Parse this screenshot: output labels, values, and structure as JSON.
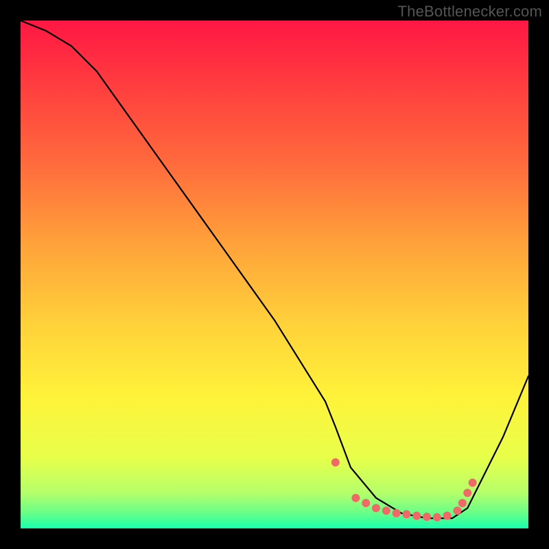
{
  "credit": "TheBottlenecker.com",
  "colors": {
    "bg_black": "#000000",
    "gradient_stops": [
      {
        "offset": 0.0,
        "color": "#ff1744"
      },
      {
        "offset": 0.12,
        "color": "#ff3b3f"
      },
      {
        "offset": 0.28,
        "color": "#ff6a3c"
      },
      {
        "offset": 0.44,
        "color": "#ffa23a"
      },
      {
        "offset": 0.6,
        "color": "#ffd23a"
      },
      {
        "offset": 0.74,
        "color": "#fff23a"
      },
      {
        "offset": 0.86,
        "color": "#e8ff4a"
      },
      {
        "offset": 0.93,
        "color": "#b4ff6a"
      },
      {
        "offset": 0.97,
        "color": "#66ff88"
      },
      {
        "offset": 1.0,
        "color": "#18ffb0"
      }
    ],
    "curve": "#000000",
    "marker_fill": "#f06868",
    "marker_stroke": "#f06868"
  },
  "chart_data": {
    "type": "line",
    "title": "",
    "xlabel": "",
    "ylabel": "",
    "xlim": [
      0,
      100
    ],
    "ylim": [
      0,
      100
    ],
    "series": [
      {
        "name": "bottleneck-curve",
        "x": [
          0,
          5,
          10,
          15,
          20,
          25,
          30,
          35,
          40,
          45,
          50,
          55,
          60,
          62,
          65,
          70,
          75,
          80,
          82,
          85,
          88,
          90,
          95,
          100
        ],
        "y": [
          100,
          98,
          95,
          90,
          83,
          76,
          69,
          62,
          55,
          48,
          41,
          33,
          25,
          20,
          12,
          6,
          3,
          2,
          2,
          2,
          4,
          8,
          18,
          30
        ]
      }
    ],
    "markers": {
      "name": "highlight-points",
      "x": [
        62,
        66,
        68,
        70,
        72,
        74,
        76,
        78,
        80,
        82,
        84,
        86,
        87,
        88,
        89
      ],
      "y": [
        13,
        6,
        5,
        4,
        3.5,
        3,
        2.8,
        2.5,
        2.3,
        2.2,
        2.5,
        3.5,
        5,
        7,
        9
      ]
    }
  }
}
